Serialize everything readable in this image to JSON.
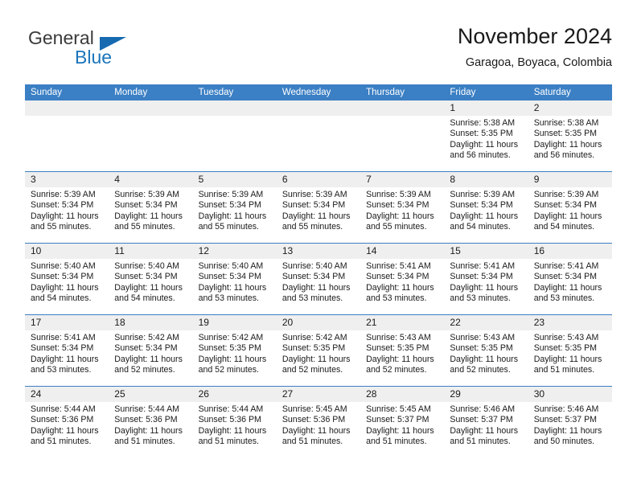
{
  "brand": {
    "name_top": "General",
    "name_bottom": "Blue",
    "color_blue": "#1b75bb",
    "color_dark": "#3a3a3a"
  },
  "header": {
    "title": "November 2024",
    "subtitle": "Garagoa, Boyaca, Colombia"
  },
  "calendar": {
    "header_bg": "#3b7fc4",
    "day_header_bg": "#efefef",
    "weekdays": [
      "Sunday",
      "Monday",
      "Tuesday",
      "Wednesday",
      "Thursday",
      "Friday",
      "Saturday"
    ],
    "weeks": [
      [
        {
          "day": "",
          "lines": []
        },
        {
          "day": "",
          "lines": []
        },
        {
          "day": "",
          "lines": []
        },
        {
          "day": "",
          "lines": []
        },
        {
          "day": "",
          "lines": []
        },
        {
          "day": "1",
          "lines": [
            "Sunrise: 5:38 AM",
            "Sunset: 5:35 PM",
            "Daylight: 11 hours",
            "and 56 minutes."
          ]
        },
        {
          "day": "2",
          "lines": [
            "Sunrise: 5:38 AM",
            "Sunset: 5:35 PM",
            "Daylight: 11 hours",
            "and 56 minutes."
          ]
        }
      ],
      [
        {
          "day": "3",
          "lines": [
            "Sunrise: 5:39 AM",
            "Sunset: 5:34 PM",
            "Daylight: 11 hours",
            "and 55 minutes."
          ]
        },
        {
          "day": "4",
          "lines": [
            "Sunrise: 5:39 AM",
            "Sunset: 5:34 PM",
            "Daylight: 11 hours",
            "and 55 minutes."
          ]
        },
        {
          "day": "5",
          "lines": [
            "Sunrise: 5:39 AM",
            "Sunset: 5:34 PM",
            "Daylight: 11 hours",
            "and 55 minutes."
          ]
        },
        {
          "day": "6",
          "lines": [
            "Sunrise: 5:39 AM",
            "Sunset: 5:34 PM",
            "Daylight: 11 hours",
            "and 55 minutes."
          ]
        },
        {
          "day": "7",
          "lines": [
            "Sunrise: 5:39 AM",
            "Sunset: 5:34 PM",
            "Daylight: 11 hours",
            "and 55 minutes."
          ]
        },
        {
          "day": "8",
          "lines": [
            "Sunrise: 5:39 AM",
            "Sunset: 5:34 PM",
            "Daylight: 11 hours",
            "and 54 minutes."
          ]
        },
        {
          "day": "9",
          "lines": [
            "Sunrise: 5:39 AM",
            "Sunset: 5:34 PM",
            "Daylight: 11 hours",
            "and 54 minutes."
          ]
        }
      ],
      [
        {
          "day": "10",
          "lines": [
            "Sunrise: 5:40 AM",
            "Sunset: 5:34 PM",
            "Daylight: 11 hours",
            "and 54 minutes."
          ]
        },
        {
          "day": "11",
          "lines": [
            "Sunrise: 5:40 AM",
            "Sunset: 5:34 PM",
            "Daylight: 11 hours",
            "and 54 minutes."
          ]
        },
        {
          "day": "12",
          "lines": [
            "Sunrise: 5:40 AM",
            "Sunset: 5:34 PM",
            "Daylight: 11 hours",
            "and 53 minutes."
          ]
        },
        {
          "day": "13",
          "lines": [
            "Sunrise: 5:40 AM",
            "Sunset: 5:34 PM",
            "Daylight: 11 hours",
            "and 53 minutes."
          ]
        },
        {
          "day": "14",
          "lines": [
            "Sunrise: 5:41 AM",
            "Sunset: 5:34 PM",
            "Daylight: 11 hours",
            "and 53 minutes."
          ]
        },
        {
          "day": "15",
          "lines": [
            "Sunrise: 5:41 AM",
            "Sunset: 5:34 PM",
            "Daylight: 11 hours",
            "and 53 minutes."
          ]
        },
        {
          "day": "16",
          "lines": [
            "Sunrise: 5:41 AM",
            "Sunset: 5:34 PM",
            "Daylight: 11 hours",
            "and 53 minutes."
          ]
        }
      ],
      [
        {
          "day": "17",
          "lines": [
            "Sunrise: 5:41 AM",
            "Sunset: 5:34 PM",
            "Daylight: 11 hours",
            "and 53 minutes."
          ]
        },
        {
          "day": "18",
          "lines": [
            "Sunrise: 5:42 AM",
            "Sunset: 5:34 PM",
            "Daylight: 11 hours",
            "and 52 minutes."
          ]
        },
        {
          "day": "19",
          "lines": [
            "Sunrise: 5:42 AM",
            "Sunset: 5:35 PM",
            "Daylight: 11 hours",
            "and 52 minutes."
          ]
        },
        {
          "day": "20",
          "lines": [
            "Sunrise: 5:42 AM",
            "Sunset: 5:35 PM",
            "Daylight: 11 hours",
            "and 52 minutes."
          ]
        },
        {
          "day": "21",
          "lines": [
            "Sunrise: 5:43 AM",
            "Sunset: 5:35 PM",
            "Daylight: 11 hours",
            "and 52 minutes."
          ]
        },
        {
          "day": "22",
          "lines": [
            "Sunrise: 5:43 AM",
            "Sunset: 5:35 PM",
            "Daylight: 11 hours",
            "and 52 minutes."
          ]
        },
        {
          "day": "23",
          "lines": [
            "Sunrise: 5:43 AM",
            "Sunset: 5:35 PM",
            "Daylight: 11 hours",
            "and 51 minutes."
          ]
        }
      ],
      [
        {
          "day": "24",
          "lines": [
            "Sunrise: 5:44 AM",
            "Sunset: 5:36 PM",
            "Daylight: 11 hours",
            "and 51 minutes."
          ]
        },
        {
          "day": "25",
          "lines": [
            "Sunrise: 5:44 AM",
            "Sunset: 5:36 PM",
            "Daylight: 11 hours",
            "and 51 minutes."
          ]
        },
        {
          "day": "26",
          "lines": [
            "Sunrise: 5:44 AM",
            "Sunset: 5:36 PM",
            "Daylight: 11 hours",
            "and 51 minutes."
          ]
        },
        {
          "day": "27",
          "lines": [
            "Sunrise: 5:45 AM",
            "Sunset: 5:36 PM",
            "Daylight: 11 hours",
            "and 51 minutes."
          ]
        },
        {
          "day": "28",
          "lines": [
            "Sunrise: 5:45 AM",
            "Sunset: 5:37 PM",
            "Daylight: 11 hours",
            "and 51 minutes."
          ]
        },
        {
          "day": "29",
          "lines": [
            "Sunrise: 5:46 AM",
            "Sunset: 5:37 PM",
            "Daylight: 11 hours",
            "and 51 minutes."
          ]
        },
        {
          "day": "30",
          "lines": [
            "Sunrise: 5:46 AM",
            "Sunset: 5:37 PM",
            "Daylight: 11 hours",
            "and 50 minutes."
          ]
        }
      ]
    ]
  }
}
